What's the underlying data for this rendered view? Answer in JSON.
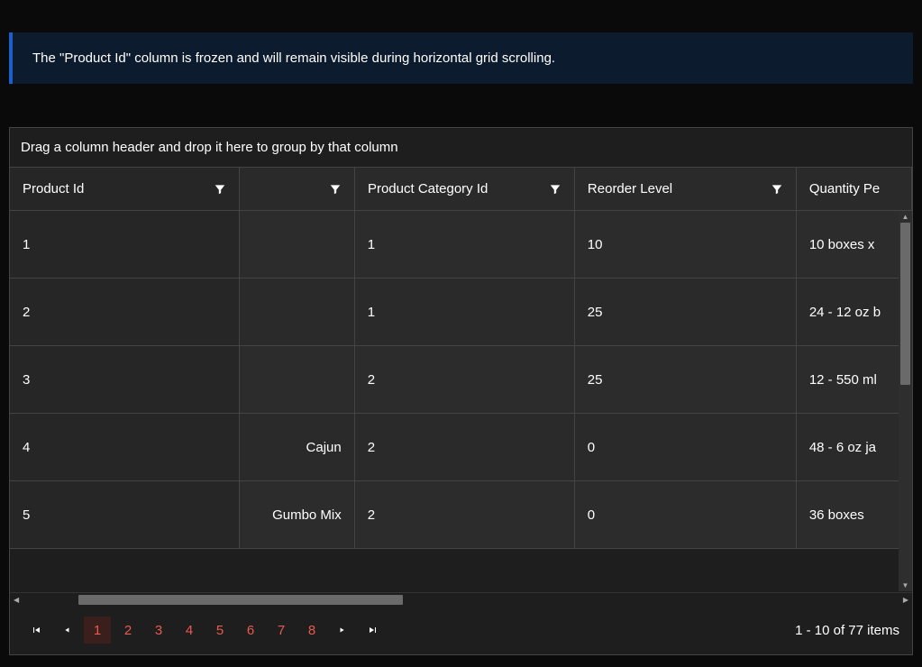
{
  "info_text": "The \"Product Id\" column is frozen and will remain visible during horizontal grid scrolling.",
  "group_panel_text": "Drag a column header and drop it here to group by that column",
  "columns": {
    "product_id": "Product Id",
    "blank": "",
    "product_category_id": "Product Category Id",
    "reorder_level": "Reorder Level",
    "quantity_per": "Quantity Pe"
  },
  "rows": [
    {
      "product_id": "1",
      "c2": "",
      "cat": "1",
      "reorder": "10",
      "qty": "10 boxes x"
    },
    {
      "product_id": "2",
      "c2": "",
      "cat": "1",
      "reorder": "25",
      "qty": "24 - 12 oz b"
    },
    {
      "product_id": "3",
      "c2": "",
      "cat": "2",
      "reorder": "25",
      "qty": "12 - 550 ml"
    },
    {
      "product_id": "4",
      "c2": "Cajun",
      "cat": "2",
      "reorder": "0",
      "qty": "48 - 6 oz ja"
    },
    {
      "product_id": "5",
      "c2": "Gumbo Mix",
      "cat": "2",
      "reorder": "0",
      "qty": "36 boxes"
    }
  ],
  "pager": {
    "pages": [
      "1",
      "2",
      "3",
      "4",
      "5",
      "6",
      "7",
      "8"
    ],
    "active_index": 0,
    "info": "1 - 10 of 77 items"
  }
}
